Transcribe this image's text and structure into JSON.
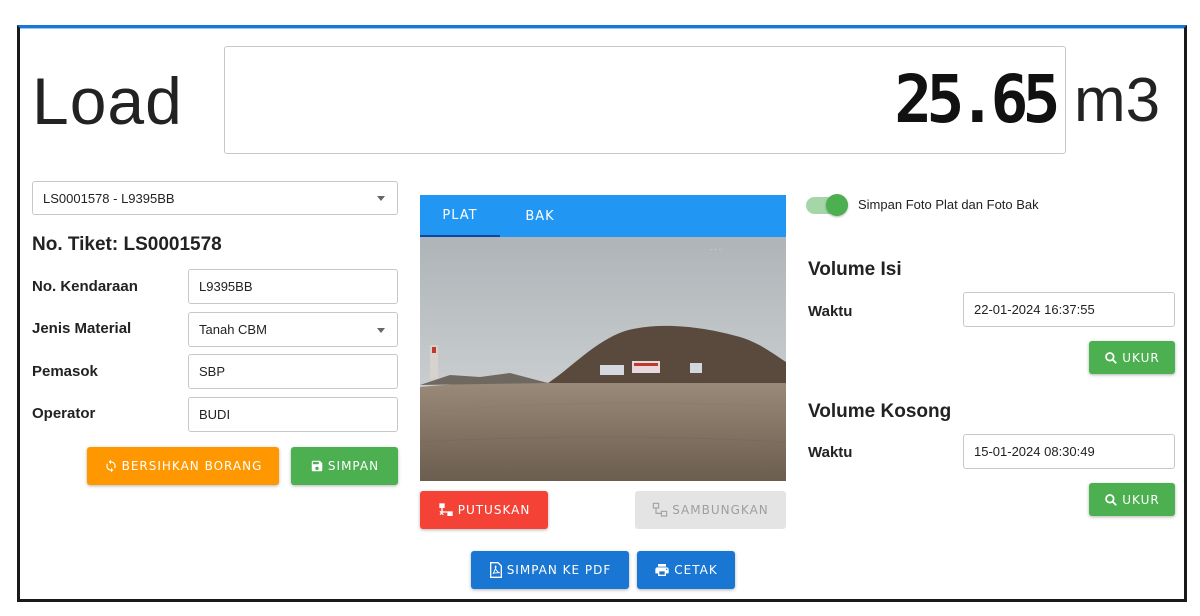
{
  "header": {
    "title": "Load",
    "reading": "25.65",
    "unit": "m3"
  },
  "left": {
    "ticket_select": "LS0001578 - L9395BB",
    "ticket_label": "No. Tiket: LS0001578",
    "fields": {
      "vehicle_label": "No. Kendaraan",
      "vehicle_value": "L9395BB",
      "material_label": "Jenis Material",
      "material_value": "Tanah CBM",
      "supplier_label": "Pemasok",
      "supplier_value": "SBP",
      "operator_label": "Operator",
      "operator_value": "BUDI"
    },
    "buttons": {
      "clear": "BERSIHKAN BORANG",
      "save": "SIMPAN"
    }
  },
  "camera": {
    "tabs": [
      "PLAT",
      "BAK"
    ],
    "active_tab": "PLAT",
    "disconnect": "PUTUSKAN",
    "connect": "SAMBUNGKAN"
  },
  "bottom": {
    "save_pdf": "SIMPAN KE PDF",
    "print": "CETAK"
  },
  "right": {
    "toggle_label": "Simpan Foto Plat dan Foto Bak",
    "toggle_on": true,
    "volume_filled": {
      "title": "Volume Isi",
      "time_label": "Waktu",
      "time_value": "22-01-2024 16:37:55",
      "measure": "UKUR"
    },
    "volume_empty": {
      "title": "Volume Kosong",
      "time_label": "Waktu",
      "time_value": "15-01-2024 08:30:49",
      "measure": "UKUR"
    }
  },
  "colors": {
    "accent": "#2196f3",
    "primary": "#1976d2",
    "success": "#4caf50",
    "warning": "#ff9800",
    "danger": "#f44336"
  },
  "icons": {
    "clear": "refresh-icon",
    "save": "floppy-icon",
    "disconnect": "network-off-icon",
    "connect": "network-icon",
    "save_pdf": "pdf-icon",
    "print": "printer-icon",
    "measure": "search-icon"
  }
}
